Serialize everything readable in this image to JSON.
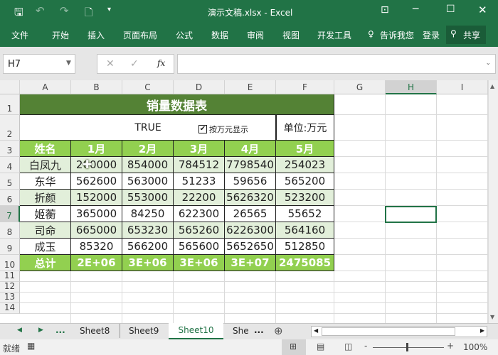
{
  "window": {
    "title": "演示文稿.xlsx - Excel"
  },
  "ribbon": {
    "tabs": [
      "文件",
      "开始",
      "插入",
      "页面布局",
      "公式",
      "数据",
      "审阅",
      "视图",
      "开发工具"
    ],
    "tell_me": "告诉我您",
    "login": "登录",
    "share": "共享"
  },
  "formula_bar": {
    "name_box": "H7",
    "fx": "fx",
    "value": ""
  },
  "columns": [
    "A",
    "B",
    "C",
    "D",
    "E",
    "F",
    "G",
    "H",
    "I"
  ],
  "rows": [
    "1",
    "2",
    "3",
    "4",
    "5",
    "6",
    "7",
    "8",
    "9",
    "10",
    "11",
    "12",
    "13",
    "14"
  ],
  "sheet": {
    "title": "销量数据表",
    "true_value": "TRUE",
    "checkbox_label": "按万元显示",
    "checkbox_checked": true,
    "unit": "单位:万元",
    "headers": [
      "姓名",
      "1月",
      "2月",
      "3月",
      "4月",
      "5月"
    ],
    "data": [
      [
        "白凤九",
        "200000",
        "854000",
        "784512",
        "7798540",
        "254023"
      ],
      [
        "东华",
        "562600",
        "563000",
        "51233",
        "59656",
        "565200"
      ],
      [
        "折颜",
        "152000",
        "553000",
        "22200",
        "5626320",
        "523200"
      ],
      [
        "姬蘅",
        "365000",
        "84250",
        "622300",
        "26565",
        "55652"
      ],
      [
        "司命",
        "665000",
        "653230",
        "565260",
        "6226300",
        "564160"
      ],
      [
        "成玉",
        "85320",
        "566200",
        "565600",
        "5652650",
        "512850"
      ]
    ],
    "totals": [
      "总计",
      "2E+06",
      "3E+06",
      "3E+06",
      "3E+07",
      "2475085"
    ]
  },
  "sheet_tabs": {
    "items": [
      "Sheet8",
      "Sheet9",
      "Sheet10",
      "She"
    ],
    "active": "Sheet10",
    "more": "..."
  },
  "status": {
    "ready": "就绪",
    "zoom": "100%"
  },
  "colors": {
    "excel_green": "#217346",
    "header_green": "#92d050",
    "title_green": "#548235",
    "stripe": "#e2efda"
  }
}
